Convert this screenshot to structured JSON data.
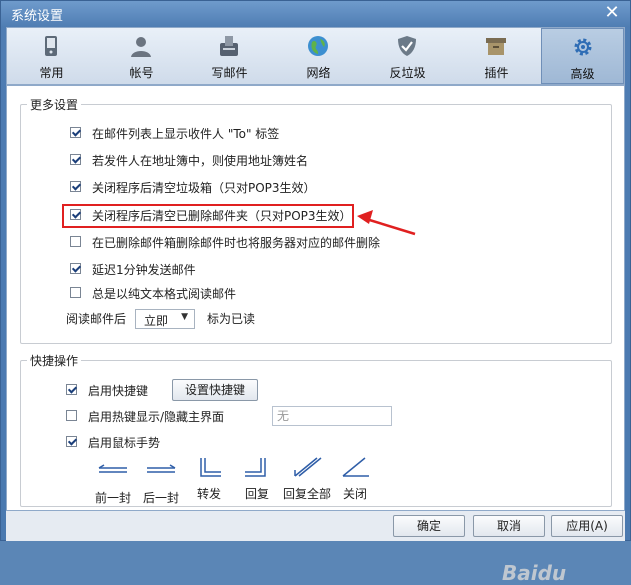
{
  "window": {
    "title": "系统设置"
  },
  "tabs": [
    {
      "label": "常用",
      "icon": "phone-icon"
    },
    {
      "label": "帐号",
      "icon": "user-icon"
    },
    {
      "label": "写邮件",
      "icon": "compose-mail-icon"
    },
    {
      "label": "网络",
      "icon": "globe-icon"
    },
    {
      "label": "反垃圾",
      "icon": "shield-icon"
    },
    {
      "label": "插件",
      "icon": "box-icon"
    },
    {
      "label": "高级",
      "icon": "gear-icon",
      "active": true
    }
  ],
  "more_settings": {
    "title": "更多设置",
    "options": [
      {
        "label": "在邮件列表上显示收件人 \"To\" 标签",
        "checked": true
      },
      {
        "label": "若发件人在地址簿中，则使用地址簿姓名",
        "checked": true
      },
      {
        "label": "关闭程序后清空垃圾箱（只对POP3生效）",
        "checked": true
      },
      {
        "label": "关闭程序后清空已删除邮件夹（只对POP3生效）",
        "checked": true,
        "highlighted": true
      },
      {
        "label": "在已删除邮件箱删除邮件时也将服务器对应的邮件删除",
        "checked": false
      },
      {
        "label": "延迟1分钟发送邮件",
        "checked": true
      },
      {
        "label": "总是以纯文本格式阅读邮件",
        "checked": false
      }
    ],
    "read_prefix": "阅读邮件后",
    "read_select_value": "立即",
    "read_suffix": "标为已读"
  },
  "shortcuts": {
    "title": "快捷操作",
    "enable_hotkeys_label": "启用快捷键",
    "enable_hotkeys_checked": true,
    "set_hotkeys_button": "设置快捷键",
    "hotkey_show_hide_label": "启用热键显示/隐藏主界面",
    "hotkey_show_hide_checked": false,
    "hotkey_value": "无",
    "mouse_gesture_label": "启用鼠标手势",
    "mouse_gesture_checked": true,
    "gestures": [
      {
        "label": "前一封",
        "icon": "gesture-left-icon"
      },
      {
        "label": "后一封",
        "icon": "gesture-right-icon"
      },
      {
        "label": "转发",
        "icon": "gesture-down-right-icon"
      },
      {
        "label": "回复",
        "icon": "gesture-down-left-icon"
      },
      {
        "label": "回复全部",
        "icon": "gesture-diagonal-double-icon"
      },
      {
        "label": "关闭",
        "icon": "gesture-diagonal-line-icon"
      }
    ]
  },
  "buttons": {
    "ok": "确定",
    "cancel": "取消",
    "apply": "应用(A)"
  },
  "colors": {
    "highlight": "#e02020",
    "arrow": "#e02020",
    "window_blue": "#4f7db3"
  }
}
